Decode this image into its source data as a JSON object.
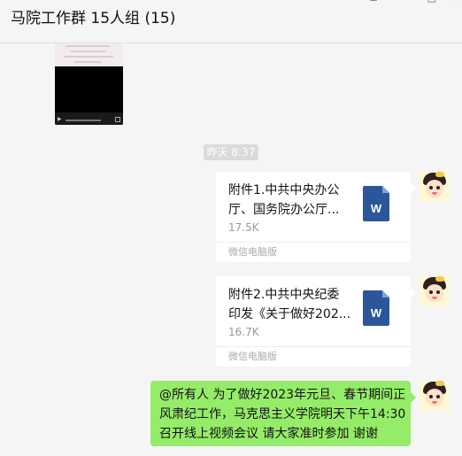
{
  "window": {
    "title": "马院工作群 15人组 (15)",
    "controls": [
      "pin-icon",
      "minimize-icon",
      "maximize-icon",
      "close-icon"
    ]
  },
  "chat": {
    "timestamp": "昨天 8:37",
    "files": [
      {
        "name_lines": [
          "附件1.中共中央办公",
          "厅、国务院办公厅..."
        ],
        "size": "17.5K",
        "source": "微信电脑版",
        "icon": "word-doc-icon",
        "icon_color": "#2b579a"
      },
      {
        "name_lines": [
          "附件2.中共中央纪委",
          "印发《关于做好202..."
        ],
        "size": "16.7K",
        "source": "微信电脑版",
        "icon": "word-doc-icon",
        "icon_color": "#2b579a"
      }
    ],
    "text_message": {
      "lines": [
        "@所有人 为了做好2023年元旦、春节期间正",
        "风肃纪工作，马克思主义学院明天下午14:30",
        "召开线上视频会议  请大家准时参加  谢谢"
      ],
      "bubble_color": "#95ec69"
    }
  },
  "colors": {
    "background": "#f5f5f5",
    "bubble_self": "#95ec69",
    "card": "#ffffff",
    "word_blue": "#2b579a"
  }
}
